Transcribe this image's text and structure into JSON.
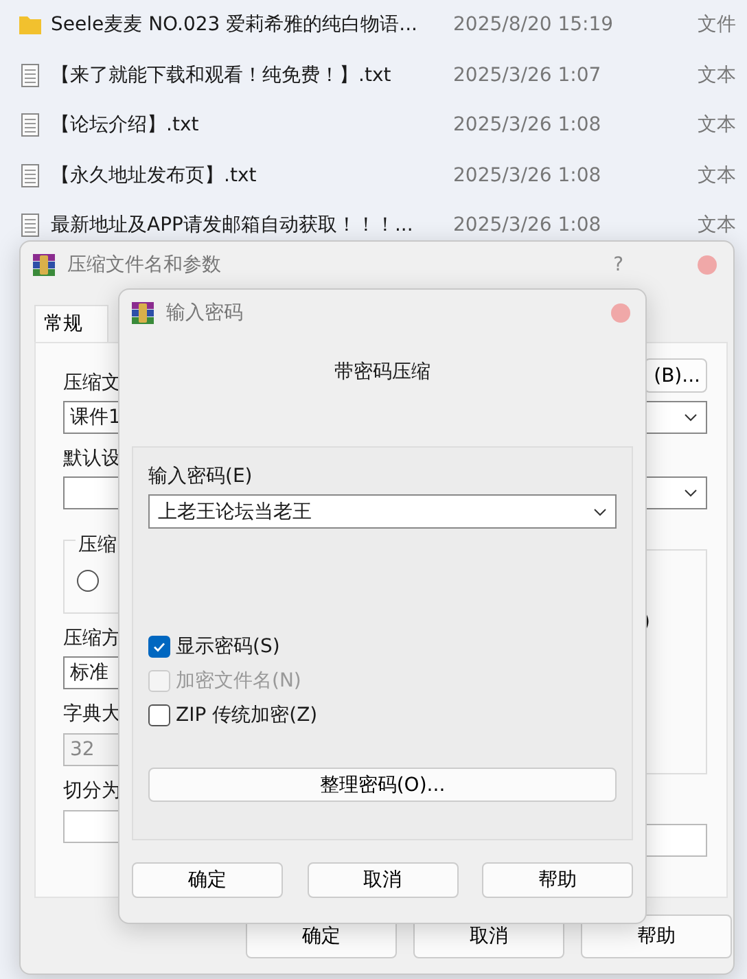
{
  "file_list": [
    {
      "kind": "folder",
      "name": "Seele麦麦 NO.023 爱莉希雅的纯白物语...",
      "modified": "2025/8/20 15:19",
      "type": "文件"
    },
    {
      "kind": "text",
      "name": "【来了就能下载和观看！纯免费！】.txt",
      "modified": "2025/3/26 1:07",
      "type": "文本"
    },
    {
      "kind": "text",
      "name": "【论坛介绍】.txt",
      "modified": "2025/3/26 1:08",
      "type": "文本"
    },
    {
      "kind": "text",
      "name": "【永久地址发布页】.txt",
      "modified": "2025/3/26 1:08",
      "type": "文本"
    },
    {
      "kind": "text",
      "name": "最新地址及APP请发邮箱自动获取！！！...",
      "modified": "2025/3/26 1:08",
      "type": "文本"
    }
  ],
  "back_dialog": {
    "title": "压缩文件名和参数",
    "help": "?",
    "tabs": [
      {
        "label": "常规",
        "selected": true
      }
    ],
    "left_items": [
      {
        "kind": "label",
        "text": "压缩文"
      },
      {
        "kind": "combo",
        "value": "课件1"
      },
      {
        "kind": "label",
        "text": "默认设"
      },
      {
        "kind": "combo"
      },
      {
        "kind": "group",
        "legend": "压缩",
        "radio_selected": false
      },
      {
        "kind": "label",
        "text": "压缩方"
      },
      {
        "kind": "combo",
        "value": "标准"
      },
      {
        "kind": "label",
        "text": "字典大"
      },
      {
        "kind": "field",
        "value": "32",
        "disabled": true
      },
      {
        "kind": "label",
        "text": "切分为"
      },
      {
        "kind": "field"
      }
    ],
    "right_items": [
      {
        "kind": "button",
        "label": "(B)..."
      },
      {
        "kind": "combo"
      },
      {
        "kind": "combo"
      },
      {
        "kind": "group",
        "text": ")"
      },
      {
        "kind": "field"
      }
    ],
    "buttons": [
      "确定",
      "取消",
      "帮助"
    ]
  },
  "password_dialog": {
    "title": "输入密码",
    "heading": "带密码压缩",
    "password_label": "输入密码(E)",
    "password_value": "上老王论坛当老王",
    "options": [
      {
        "label": "显示密码(S)",
        "checked": true,
        "disabled": false
      },
      {
        "label": "加密文件名(N)",
        "checked": false,
        "disabled": true
      },
      {
        "label": "ZIP 传统加密(Z)",
        "checked": false,
        "disabled": false
      }
    ],
    "organize_button": "整理密码(O)...",
    "buttons": [
      "确定",
      "取消",
      "帮助"
    ]
  }
}
